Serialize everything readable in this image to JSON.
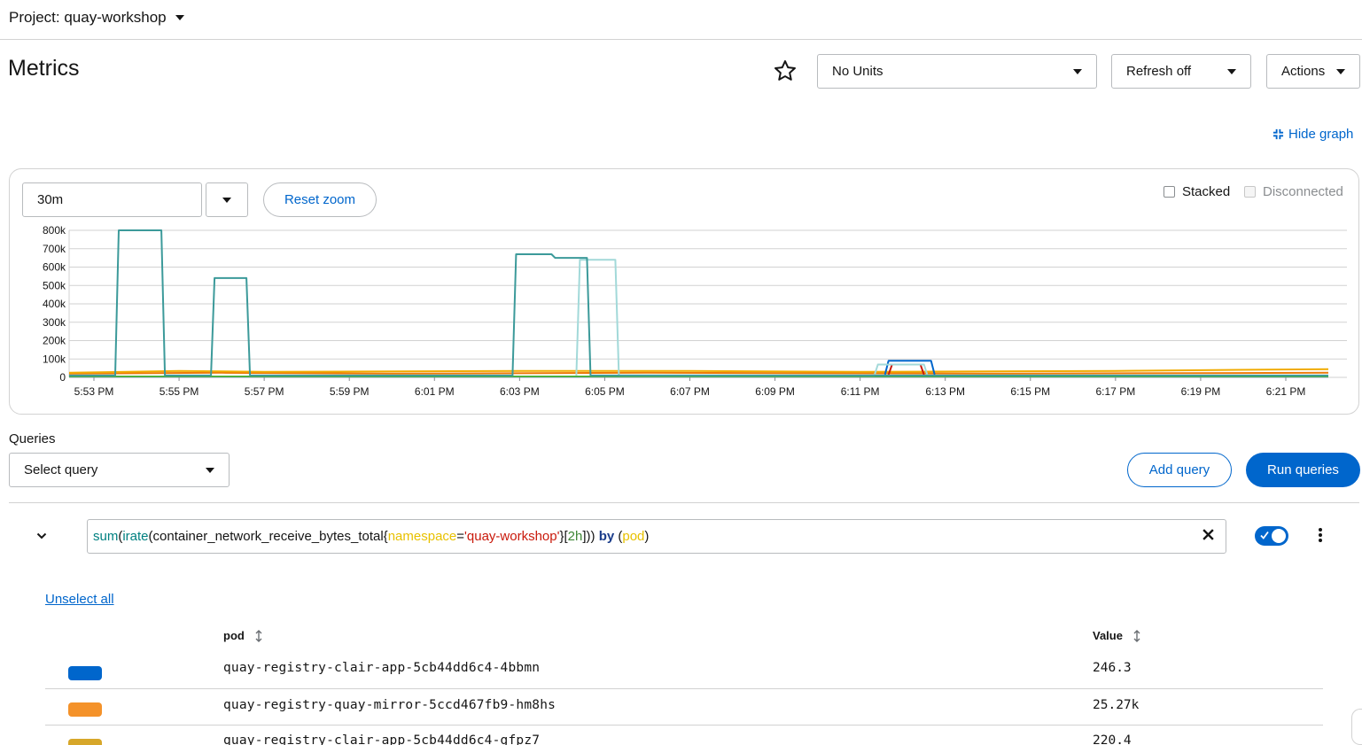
{
  "project": {
    "label": "Project: quay-workshop"
  },
  "page": {
    "title": "Metrics"
  },
  "toolbar": {
    "units": "No Units",
    "refresh": "Refresh off",
    "actions": "Actions",
    "hide_graph": "Hide graph"
  },
  "graph": {
    "range": "30m",
    "reset_zoom": "Reset zoom",
    "stacked": "Stacked",
    "disconnected": "Disconnected"
  },
  "chart_data": {
    "type": "line",
    "x": [
      "5:53 PM",
      "5:55 PM",
      "5:57 PM",
      "5:59 PM",
      "6:01 PM",
      "6:03 PM",
      "6:05 PM",
      "6:07 PM",
      "6:09 PM",
      "6:11 PM",
      "6:13 PM",
      "6:15 PM",
      "6:17 PM",
      "6:19 PM",
      "6:21 PM"
    ],
    "y_ticks": [
      "0",
      "100k",
      "200k",
      "300k",
      "400k",
      "500k",
      "600k",
      "700k",
      "800k"
    ],
    "ylim": [
      0,
      800000
    ],
    "series": [
      {
        "color": "#3c9a9a",
        "points": [
          [
            "5:52 PM",
            10000
          ],
          [
            "5:53:30 PM",
            10000
          ],
          [
            "5:53:35 PM",
            800000
          ],
          [
            "5:54:35 PM",
            800000
          ],
          [
            "5:54:40 PM",
            10000
          ],
          [
            "5:55:45 PM",
            10000
          ],
          [
            "5:55:50 PM",
            540000
          ],
          [
            "5:56:35 PM",
            540000
          ],
          [
            "5:56:40 PM",
            10000
          ],
          [
            "6:02:50 PM",
            10000
          ],
          [
            "6:02:55 PM",
            670000
          ],
          [
            "6:03:45 PM",
            670000
          ],
          [
            "6:03:50 PM",
            650000
          ],
          [
            "6:04:35 PM",
            650000
          ],
          [
            "6:04:40 PM",
            10000
          ],
          [
            "6:22 PM",
            10000
          ]
        ]
      },
      {
        "color": "#a2d9d9",
        "points": [
          [
            "6:04:20 PM",
            10000
          ],
          [
            "6:04:25 PM",
            640000
          ],
          [
            "6:05:15 PM",
            640000
          ],
          [
            "6:05:20 PM",
            10000
          ],
          [
            "6:11:20 PM",
            10000
          ],
          [
            "6:11:25 PM",
            70000
          ],
          [
            "6:12:30 PM",
            70000
          ],
          [
            "6:12:35 PM",
            10000
          ]
        ]
      },
      {
        "color": "#0066cc",
        "points": [
          [
            "6:11:35 PM",
            15000
          ],
          [
            "6:11:40 PM",
            90000
          ],
          [
            "6:12:40 PM",
            90000
          ],
          [
            "6:12:45 PM",
            15000
          ]
        ]
      },
      {
        "color": "#c9190b",
        "points": [
          [
            "6:11:40 PM",
            15000
          ],
          [
            "6:11:45 PM",
            70000
          ],
          [
            "6:12:25 PM",
            70000
          ],
          [
            "6:12:30 PM",
            15000
          ]
        ]
      },
      {
        "color": "#f0ab00",
        "points": [
          [
            "5:52 PM",
            25000
          ],
          [
            "5:55 PM",
            35000
          ],
          [
            "5:57 PM",
            30000
          ],
          [
            "6:03 PM",
            35000
          ],
          [
            "6:07 PM",
            35000
          ],
          [
            "6:11 PM",
            30000
          ],
          [
            "6:17 PM",
            35000
          ],
          [
            "6:22 PM",
            45000
          ]
        ]
      },
      {
        "color": "#ec7a08",
        "points": [
          [
            "5:52 PM",
            20000
          ],
          [
            "5:56 PM",
            25000
          ],
          [
            "6:00 PM",
            20000
          ],
          [
            "6:06 PM",
            25000
          ],
          [
            "6:14 PM",
            20000
          ],
          [
            "6:22 PM",
            25000
          ]
        ]
      },
      {
        "color": "#4cb140",
        "points": [
          [
            "5:52 PM",
            5000
          ],
          [
            "6:22 PM",
            5000
          ]
        ]
      },
      {
        "color": "#8481dd",
        "points": [
          [
            "5:52 PM",
            3000
          ],
          [
            "6:22 PM",
            3000
          ]
        ]
      }
    ]
  },
  "queries": {
    "label": "Queries",
    "select_placeholder": "Select query",
    "add_query": "Add query",
    "run_queries": "Run queries",
    "expression_parts": {
      "sum": "sum",
      "p1": "(",
      "irate": "irate",
      "p2": "(container_network_receive_bytes_total{",
      "label": "namespace",
      "eq": "=",
      "value": "'quay-workshop'",
      "p3": "}[",
      "range": "2h",
      "p4": "])) ",
      "by": "by",
      "p5": " (",
      "group": "pod",
      "p6": ")"
    }
  },
  "results": {
    "unselect_all": "Unselect all",
    "col_pod": "pod",
    "col_value": "Value",
    "rows": [
      {
        "color": "#0066cc",
        "pod": "quay-registry-clair-app-5cb44dd6c4-4bbmn",
        "value": "246.3"
      },
      {
        "color": "#f4922a",
        "pod": "quay-registry-quay-mirror-5ccd467fb9-hm8hs",
        "value": "25.27k"
      },
      {
        "color": "#d7a72a",
        "pod": "quay-registry-clair-app-5cb44dd6c4-gfpz7",
        "value": "220.4"
      }
    ]
  }
}
